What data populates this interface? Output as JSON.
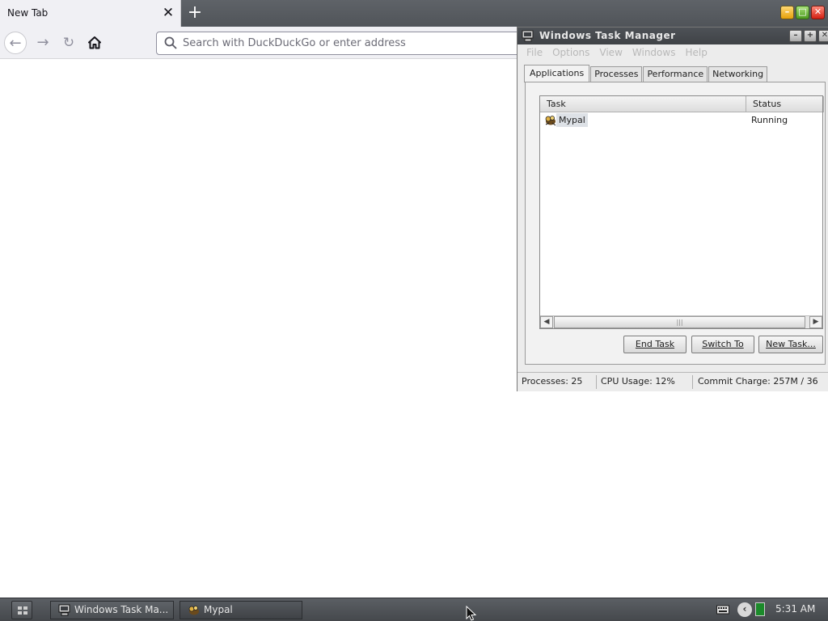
{
  "browser": {
    "tab": {
      "title": "New Tab",
      "close": "✕"
    },
    "new_tab_glyph": "+",
    "nav": {
      "back": "←",
      "forward": "→",
      "reload": "↻",
      "home": "⌂"
    },
    "urlbar": {
      "placeholder": "Search with DuckDuckGo or enter address",
      "value": ""
    }
  },
  "window_controls": {
    "min": "–",
    "max": "□",
    "close": "✕"
  },
  "task_manager": {
    "title": "Windows Task Manager",
    "window_buttons": {
      "min": "–",
      "max": "+",
      "close": "✕"
    },
    "menu": [
      "File",
      "Options",
      "View",
      "Windows",
      "Help"
    ],
    "tabs": [
      "Applications",
      "Processes",
      "Performance",
      "Networking"
    ],
    "active_tab": "Applications",
    "columns": {
      "task": "Task",
      "status": "Status"
    },
    "rows": [
      {
        "task": "Mypal",
        "status": "Running"
      }
    ],
    "buttons": {
      "end_task": "End Task",
      "switch_to": "Switch To",
      "new_task": "New Task..."
    },
    "statusbar": {
      "processes": "Processes: 25",
      "cpu": "CPU Usage: 12%",
      "commit": "Commit Charge: 257M / 36"
    }
  },
  "taskbar": {
    "items": [
      {
        "label": "Windows Task Ma...",
        "icon": "computer-icon"
      },
      {
        "label": "Mypal",
        "icon": "mypal-icon"
      }
    ],
    "clock": "5:31 AM"
  }
}
